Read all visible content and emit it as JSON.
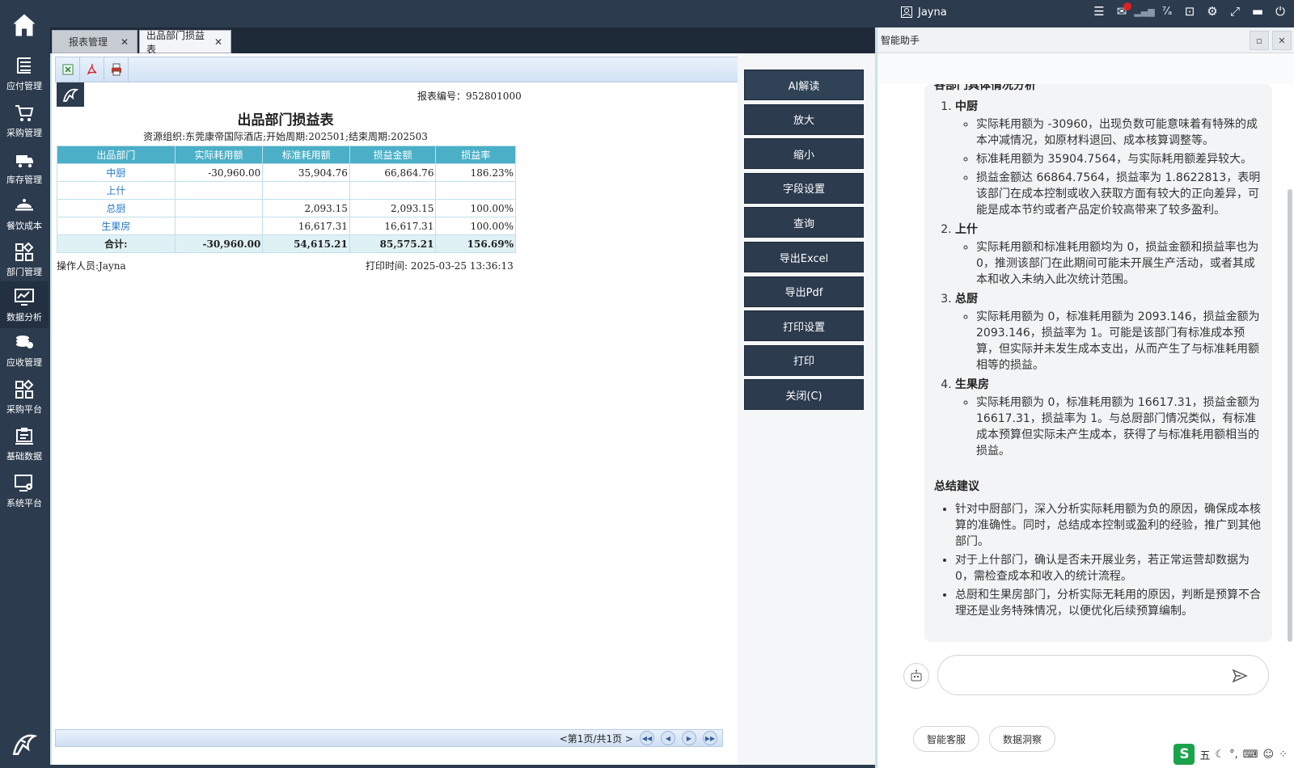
{
  "topbar": {
    "user": "Jayna"
  },
  "sidebar": {
    "items": [
      {
        "label": "应付管理",
        "icon": "payable-icon"
      },
      {
        "label": "采购管理",
        "icon": "cart-icon"
      },
      {
        "label": "库存管理",
        "icon": "truck-icon"
      },
      {
        "label": "餐饮成本",
        "icon": "cost-icon"
      },
      {
        "label": "部门管理",
        "icon": "grid-icon"
      },
      {
        "label": "数据分析",
        "icon": "chart-icon"
      },
      {
        "label": "应收管理",
        "icon": "coins-icon"
      },
      {
        "label": "采购平台",
        "icon": "platform-icon"
      },
      {
        "label": "基础数据",
        "icon": "clipboard-icon"
      },
      {
        "label": "系统平台",
        "icon": "settings-monitor-icon"
      }
    ]
  },
  "tabs": [
    {
      "label": "报表管理"
    },
    {
      "label": "出品部门损益表"
    }
  ],
  "report": {
    "report_no": "报表编号：952801000",
    "title": "出品部门损益表",
    "subtitle": "资源组织:东莞康帝国际酒店;开始周期:202501;结束周期:202503",
    "columns": [
      "出品部门",
      "实际耗用额",
      "标准耗用额",
      "损益金额",
      "损益率"
    ],
    "rows": [
      {
        "dept": "中厨",
        "actual": "-30,960.00",
        "standard": "35,904.76",
        "profit": "66,864.76",
        "rate": "186.23%"
      },
      {
        "dept": "上什",
        "actual": "",
        "standard": "",
        "profit": "",
        "rate": ""
      },
      {
        "dept": "总厨",
        "actual": "",
        "standard": "2,093.15",
        "profit": "2,093.15",
        "rate": "100.00%"
      },
      {
        "dept": "生果房",
        "actual": "",
        "standard": "16,617.31",
        "profit": "16,617.31",
        "rate": "100.00%"
      }
    ],
    "total": {
      "label": "合计:",
      "actual": "-30,960.00",
      "standard": "54,615.21",
      "profit": "85,575.21",
      "rate": "156.69%"
    },
    "operator": "操作人员:Jayna",
    "print_time": "打印时间: 2025-03-25 13:36:13",
    "pager": "<第1页/共1页 >"
  },
  "actions": [
    "AI解读",
    "放大",
    "缩小",
    "字段设置",
    "查询",
    "导出Excel",
    "导出Pdf",
    "打印设置",
    "打印",
    "关闭(C)"
  ],
  "assistant": {
    "title": "智能助手",
    "heading": "各部门具体情况分析",
    "depts": [
      {
        "name": "中厨",
        "points": [
          "实际耗用额为 -30960，出现负数可能意味着有特殊的成本冲减情况，如原材料退回、成本核算调整等。",
          "标准耗用额为 35904.7564，与实际耗用额差异较大。",
          "损益金额达 66864.7564，损益率为 1.8622813，表明该部门在成本控制或收入获取方面有较大的正向差异，可能是成本节约或者产品定价较高带来了较多盈利。"
        ]
      },
      {
        "name": "上什",
        "points": [
          "实际耗用额和标准耗用额均为 0，损益金额和损益率也为 0，推测该部门在此期间可能未开展生产活动，或者其成本和收入未纳入此次统计范围。"
        ]
      },
      {
        "name": "总厨",
        "points": [
          "实际耗用额为 0，标准耗用额为 2093.146，损益金额为 2093.146，损益率为 1。可能是该部门有标准成本预算，但实际并未发生成本支出，从而产生了与标准耗用额相等的损益。"
        ]
      },
      {
        "name": "生果房",
        "points": [
          "实际耗用额为 0，标准耗用额为 16617.31，损益金额为 16617.31，损益率为 1。与总厨部门情况类似，有标准成本预算但实际未产生成本，获得了与标准耗用额相当的损益。"
        ]
      }
    ],
    "summary_title": "总结建议",
    "summary": [
      "针对中厨部门，深入分析实际耗用额为负的原因，确保成本核算的准确性。同时，总结成本控制或盈利的经验，推广到其他部门。",
      "对于上什部门，确认是否未开展业务，若正常运营却数据为 0，需检查成本和收入的统计流程。",
      "总厨和生果房部门，分析实际无耗用的原因，判断是预算不合理还是业务特殊情况，以便优化后续预算编制。"
    ],
    "input_placeholder": "",
    "quick": [
      "智能客服",
      "数据洞察"
    ]
  },
  "ime": {
    "mode": "五",
    "punct": "°,"
  }
}
